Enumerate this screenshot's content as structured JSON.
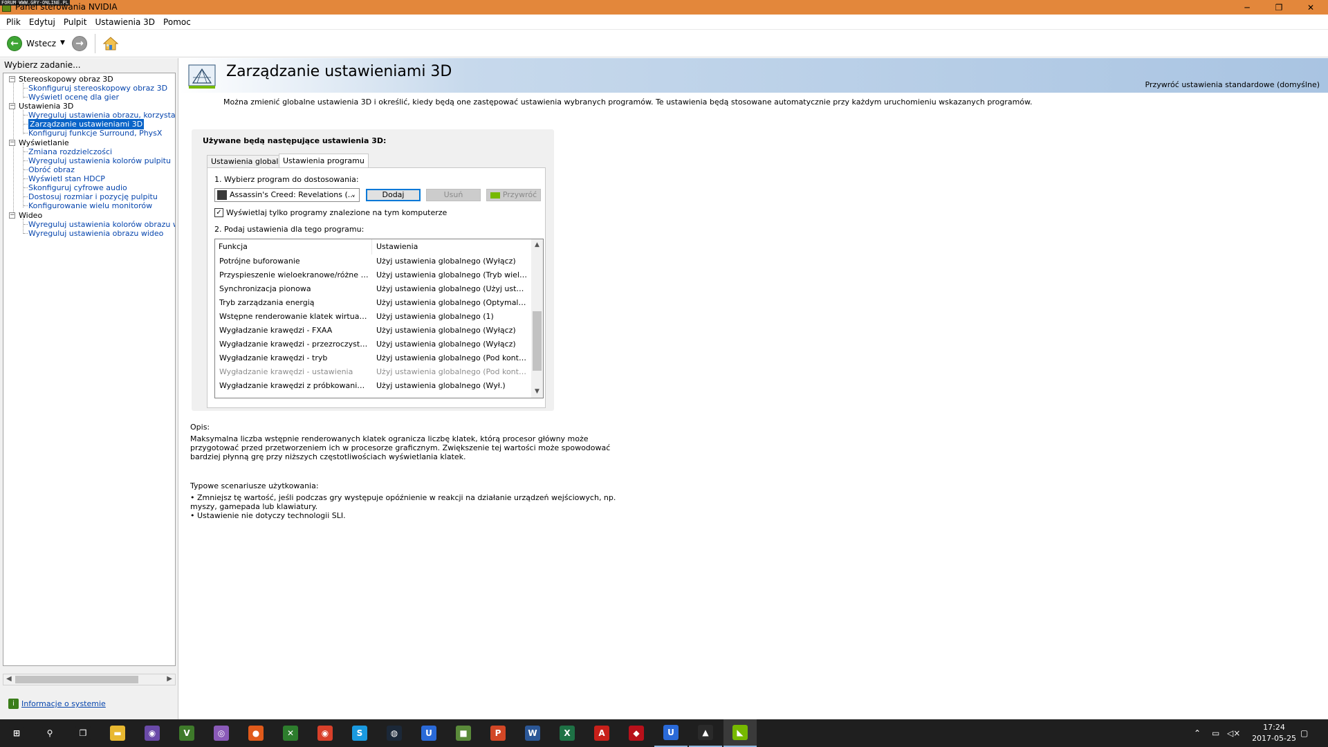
{
  "window": {
    "title": "Panel sterowania NVIDIA",
    "watermark": "FORUM.WWW.GRY-ONLINE.PL",
    "minimize": "─",
    "restore": "❐",
    "close": "✕"
  },
  "menu": [
    "Plik",
    "Edytuj",
    "Pulpit",
    "Ustawienia 3D",
    "Pomoc"
  ],
  "toolbar": {
    "back_label": "Wstecz",
    "back_glyph": "←",
    "forward_glyph": "→",
    "dropdown_glyph": "▼"
  },
  "left_pane": {
    "header": "Wybierz zadanie...",
    "tree": [
      {
        "type": "cat",
        "label": "Stereoskopowy obraz 3D"
      },
      {
        "type": "link",
        "label": "Skonfiguruj stereoskopowy obraz 3D"
      },
      {
        "type": "link",
        "label": "Wyświetl ocenę dla gier"
      },
      {
        "type": "cat",
        "label": "Ustawienia 3D"
      },
      {
        "type": "link",
        "label": "Wyreguluj ustawienia obrazu, korzystając z podglądu"
      },
      {
        "type": "link",
        "label": "Zarządzanie ustawieniami 3D",
        "selected": true
      },
      {
        "type": "link",
        "label": "Konfiguruj funkcje Surround, PhysX"
      },
      {
        "type": "cat",
        "label": "Wyświetlanie"
      },
      {
        "type": "link",
        "label": "Zmiana rozdzielczości"
      },
      {
        "type": "link",
        "label": "Wyreguluj ustawienia kolorów pulpitu"
      },
      {
        "type": "link",
        "label": "Obróć obraz"
      },
      {
        "type": "link",
        "label": "Wyświetl stan HDCP"
      },
      {
        "type": "link",
        "label": "Skonfiguruj cyfrowe audio"
      },
      {
        "type": "link",
        "label": "Dostosuj rozmiar i pozycję pulpitu"
      },
      {
        "type": "link",
        "label": "Konfigurowanie wielu monitorów"
      },
      {
        "type": "cat",
        "label": "Wideo"
      },
      {
        "type": "link",
        "label": "Wyreguluj ustawienia kolorów obrazu wideo"
      },
      {
        "type": "link",
        "label": "Wyreguluj ustawienia obrazu wideo"
      }
    ],
    "system_info": "Informacje o systemie"
  },
  "main": {
    "title": "Zarządzanie ustawieniami 3D",
    "restore_defaults": "Przywróć ustawienia standardowe (domyślne)",
    "intro": "Można zmienić globalne ustawienia 3D i określić, kiedy będą one zastępować ustawienia wybranych programów. Te ustawienia będą stosowane automatycznie przy każdym uruchomieniu wskazanych programów.",
    "settings_title": "Używane będą następujące ustawienia 3D:",
    "tabs": [
      {
        "label": "Ustawienia globalne",
        "active": false
      },
      {
        "label": "Ustawienia programu",
        "active": true
      }
    ],
    "step1": "1. Wybierz program do dostosowania:",
    "program_selected": "Assassin's Creed: Revelations (...",
    "btn_add": "Dodaj",
    "btn_remove": "Usuń",
    "btn_restore": "Przywróć",
    "checkbox_label": "Wyświetlaj tylko programy znalezione na tym komputerze",
    "checkbox_checked": true,
    "step2": "2. Podaj ustawienia dla tego programu:",
    "grid_headers": [
      "Funkcja",
      "Ustawienia"
    ],
    "grid_rows": [
      {
        "f": "Potrójne buforowanie",
        "s": "Użyj ustawienia globalnego (Wyłącz)",
        "disabled": false
      },
      {
        "f": "Przyspieszenie wieloekranowe/różne proc...",
        "s": "Użyj ustawienia globalnego (Tryb wieloekr...",
        "disabled": false
      },
      {
        "f": "Synchronizacja pionowa",
        "s": "Użyj ustawienia globalnego (Użyj ustawien...",
        "disabled": false
      },
      {
        "f": "Tryb zarządzania energią",
        "s": "Użyj ustawienia globalnego (Optymalna moc)",
        "disabled": false
      },
      {
        "f": "Wstępne renderowanie klatek wirtualnej r...",
        "s": "Użyj ustawienia globalnego (1)",
        "disabled": false
      },
      {
        "f": "Wygładzanie krawędzi - FXAA",
        "s": "Użyj ustawienia globalnego (Wyłącz)",
        "disabled": false
      },
      {
        "f": "Wygładzanie krawędzi - przezroczystość",
        "s": "Użyj ustawienia globalnego (Wyłącz)",
        "disabled": false
      },
      {
        "f": "Wygładzanie krawędzi - tryb",
        "s": "Użyj ustawienia globalnego (Pod kontrolą ...",
        "disabled": false
      },
      {
        "f": "Wygładzanie krawędzi - ustawienia",
        "s": "Użyj ustawienia globalnego (Pod kontrolą ...",
        "disabled": true
      },
      {
        "f": "Wygładzanie krawędzi z próbkowaniem wi...",
        "s": "Użyj ustawienia globalnego (Wył.)",
        "disabled": false
      }
    ],
    "desc_label": "Opis:",
    "desc_text": "Maksymalna liczba wstępnie renderowanych klatek ogranicza liczbę klatek, którą procesor główny może przygotować przed przetworzeniem ich w procesorze graficznym. Zwiększenie tej wartości może spowodować bardziej płynną grę przy niższych częstotliwościach wyświetlania klatek.",
    "usage_label": "Typowe scenariusze użytkowania:",
    "usage_items": [
      "• Zmniejsz tę wartość, jeśli podczas gry występuje opóźnienie w reakcji na działanie urządzeń wejściowych, np. myszy, gamepada lub klawiatury.",
      "• Ustawienie nie dotyczy technologii SLI."
    ]
  },
  "taskbar": {
    "apps": [
      {
        "name": "windows-start-icon",
        "glyph": "⊞",
        "color": "#1f1f1f"
      },
      {
        "name": "search-icon",
        "glyph": "⚲",
        "color": "#1f1f1f"
      },
      {
        "name": "task-view-icon",
        "glyph": "❐",
        "color": "#1f1f1f"
      },
      {
        "name": "file-explorer-icon",
        "glyph": "▬",
        "color": "#e8b830"
      },
      {
        "name": "browser-icon",
        "glyph": "◉",
        "color": "#6a4aa8"
      },
      {
        "name": "vlc-icon",
        "glyph": "V",
        "color": "#3e7a2a"
      },
      {
        "name": "app-icon",
        "glyph": "◎",
        "color": "#8a5ab8"
      },
      {
        "name": "origin-icon",
        "glyph": "●",
        "color": "#e05a1a"
      },
      {
        "name": "xbox-icon",
        "glyph": "✕",
        "color": "#2d7d2d"
      },
      {
        "name": "chrome-icon",
        "glyph": "◉",
        "color": "#d8402a"
      },
      {
        "name": "skype-icon",
        "glyph": "S",
        "color": "#1a9ae0"
      },
      {
        "name": "steam-icon",
        "glyph": "◍",
        "color": "#1b2838"
      },
      {
        "name": "uplay-icon",
        "glyph": "U",
        "color": "#2a6ad8"
      },
      {
        "name": "minecraft-icon",
        "glyph": "■",
        "color": "#5a8a3a"
      },
      {
        "name": "powerpoint-icon",
        "glyph": "P",
        "color": "#d24726"
      },
      {
        "name": "word-icon",
        "glyph": "W",
        "color": "#2b5797"
      },
      {
        "name": "excel-icon",
        "glyph": "X",
        "color": "#1e7145"
      },
      {
        "name": "acrobat-icon",
        "glyph": "A",
        "color": "#c8201a"
      },
      {
        "name": "game-icon",
        "glyph": "◆",
        "color": "#b8101a"
      },
      {
        "name": "uplay-running-icon",
        "glyph": "U",
        "color": "#2a6ad8"
      },
      {
        "name": "assassins-creed-icon",
        "glyph": "▲",
        "color": "#2a2a2a"
      },
      {
        "name": "nvidia-icon",
        "glyph": "◣",
        "color": "#76b900"
      }
    ],
    "time": "17:24",
    "date": "2017-05-25",
    "tray_up": "⌃",
    "tray_network": "▭",
    "tray_volume": "◁×",
    "notifications": "▢"
  },
  "colors": {
    "titlebar": "#e3873b",
    "selection": "#0a64c8",
    "link": "#0645ad",
    "nvidia_green": "#76b900"
  }
}
